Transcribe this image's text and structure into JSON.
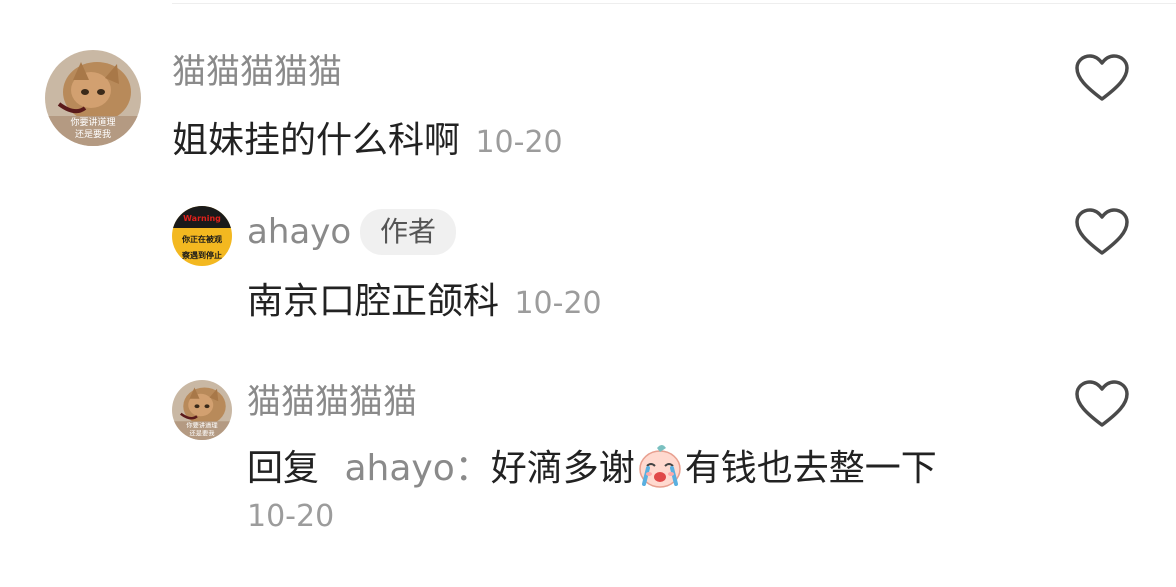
{
  "comments": [
    {
      "username": "猫猫猫猫猫",
      "text": "姐妹挂的什么科啊",
      "date": "10-20",
      "avatar_caption_line1": "你要讲道理",
      "avatar_caption_line2": "还是要我"
    },
    {
      "username": "ahayo",
      "badge": "作者",
      "text": "南京口腔正颌科",
      "date": "10-20",
      "avatar_text_line1": "Warning",
      "avatar_text_line2": "你正在被观",
      "avatar_text_line3": "察遇到停止"
    },
    {
      "username": "猫猫猫猫猫",
      "reply_prefix": "回复",
      "reply_target": "ahayo",
      "reply_colon": "：",
      "text_before_emoji": "好滴多谢",
      "emoji": "crying-baby-emoji",
      "text_after_emoji": "有钱也去整一下",
      "date": "10-20",
      "avatar_caption_line1": "你要讲道理",
      "avatar_caption_line2": "还是要我"
    }
  ],
  "icons": {
    "like": "heart-outline-icon"
  },
  "colors": {
    "username": "#8a8a8a",
    "text": "#222222",
    "date": "#9c9c9c",
    "badge_bg": "#f0f0f0",
    "heart_stroke": "#4a4a4a"
  }
}
